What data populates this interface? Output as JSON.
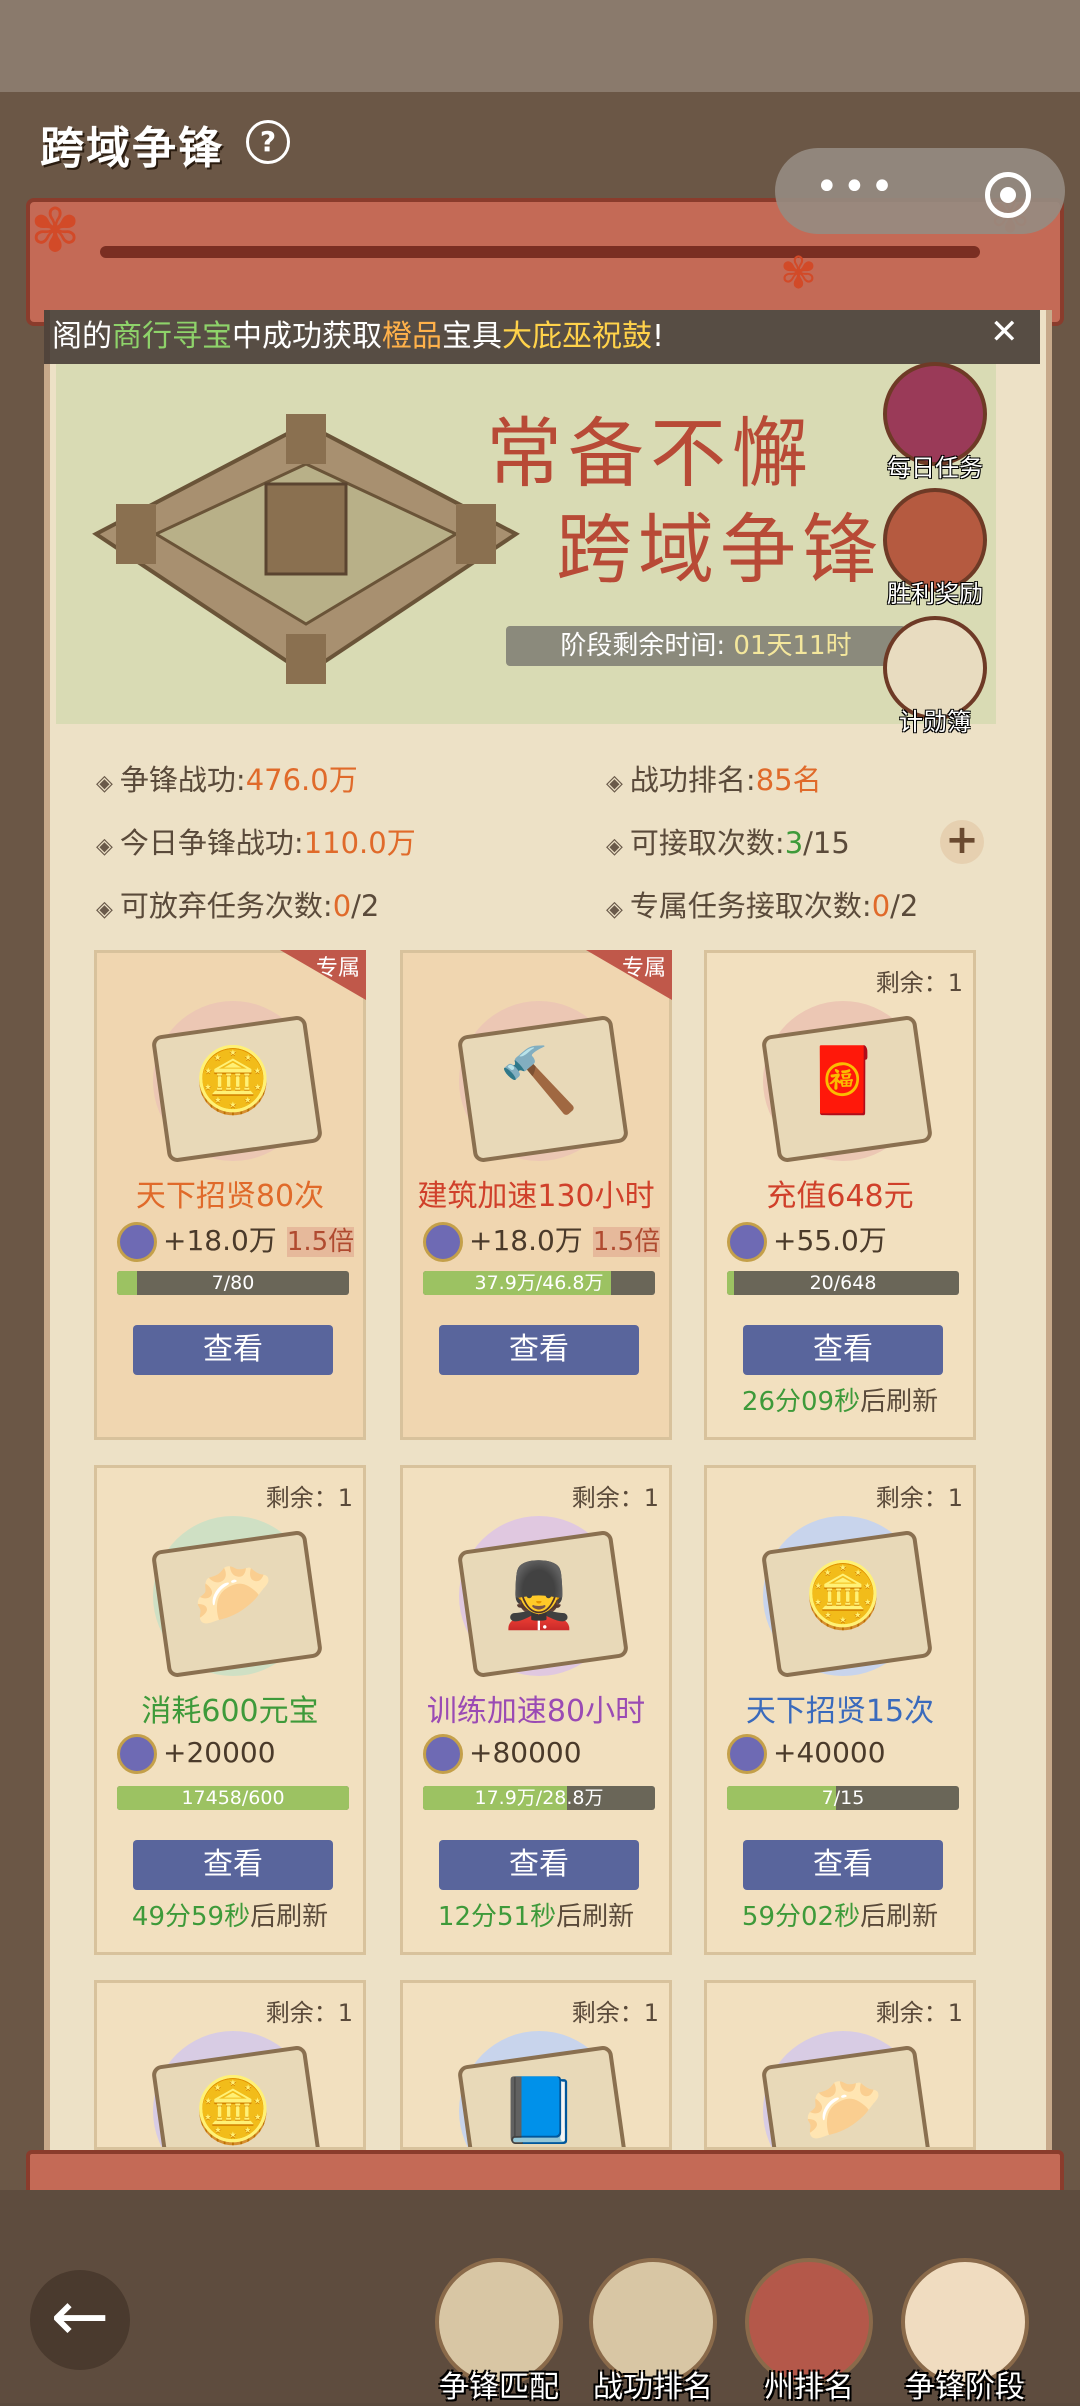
{
  "header": {
    "title": "跨域争锋",
    "help_icon": "?",
    "capsule_more": "•••"
  },
  "ticker": {
    "p1": "阁的",
    "p2": "商行寻宝",
    "p3": "中成功获取",
    "p4": "橙品",
    "p5": "宝具",
    "p6": "大庇巫祝鼓",
    "p7": "!",
    "close": "✕"
  },
  "banner": {
    "slogan_line1": "常备不懈",
    "slogan_line2": "跨域争锋",
    "timer_label": "阶段剩余时间:",
    "timer_value": "01天11时"
  },
  "side_buttons": {
    "daily": "每日任务",
    "victory": "胜利奖励",
    "merit": "计勋簿"
  },
  "stats": {
    "battle_merit_label": "争锋战功:",
    "battle_merit_value": "476.0万",
    "rank_label": "战功排名:",
    "rank_value": "85名",
    "today_merit_label": "今日争锋战功:",
    "today_merit_value": "110.0万",
    "accept_label": "可接取次数:",
    "accept_current": "3",
    "accept_total": "/15",
    "abandon_label": "可放弃任务次数:",
    "abandon_current": "0",
    "abandon_total": "/2",
    "exclusive_label": "专属任务接取次数:",
    "exclusive_current": "0",
    "exclusive_total": "/2"
  },
  "tasks": [
    {
      "badge": "专属",
      "name": "天下招贤80次",
      "reward": "+18.0万",
      "multiplier": "1.5倍",
      "progress": "7/80",
      "progress_ratio": 0.0875,
      "button": "查看"
    },
    {
      "badge": "专属",
      "name": "建筑加速130小时",
      "reward": "+18.0万",
      "multiplier": "1.5倍",
      "progress": "37.9万/46.8万",
      "progress_ratio": 0.81,
      "button": "查看"
    },
    {
      "remain": "剩余：1",
      "name": "充值648元",
      "reward": "+55.0万",
      "progress": "20/648",
      "progress_ratio": 0.03,
      "button": "查看",
      "refresh_time": "26分09秒",
      "refresh_suffix": "后刷新"
    },
    {
      "remain": "剩余：1",
      "name": "消耗600元宝",
      "reward": "+20000",
      "progress": "17458/600",
      "progress_ratio": 1.0,
      "button": "查看",
      "refresh_time": "49分59秒",
      "refresh_suffix": "后刷新"
    },
    {
      "remain": "剩余：1",
      "name": "训练加速80小时",
      "reward": "+80000",
      "progress": "17.9万/28.8万",
      "progress_ratio": 0.62,
      "button": "查看",
      "refresh_time": "12分51秒",
      "refresh_suffix": "后刷新"
    },
    {
      "remain": "剩余：1",
      "name": "天下招贤15次",
      "reward": "+40000",
      "progress": "7/15",
      "progress_ratio": 0.47,
      "button": "查看",
      "refresh_time": "59分02秒",
      "refresh_suffix": "后刷新"
    },
    {
      "remain": "剩余：1"
    },
    {
      "remain": "剩余：1"
    },
    {
      "remain": "剩余：1"
    }
  ],
  "nav": {
    "match": "争锋匹配",
    "ranking": "战功排名",
    "state_rank": "州排名",
    "stage": "争锋阶段"
  }
}
